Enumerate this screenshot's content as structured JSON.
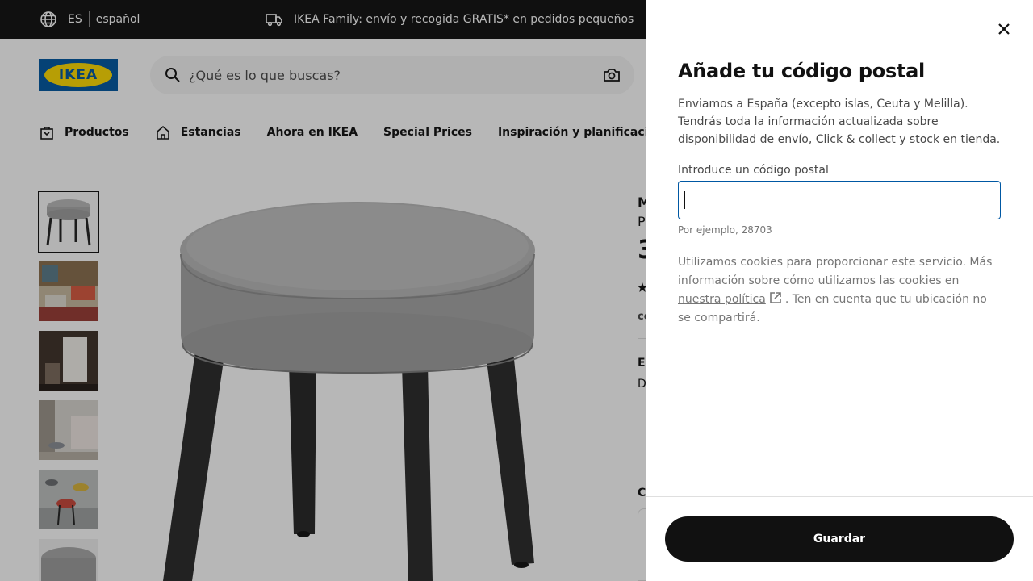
{
  "topbar": {
    "language_code": "ES",
    "language_name": "español",
    "promo_text": "IKEA Family: envío y recogida GRATIS* en pedidos pequeños"
  },
  "header": {
    "logo_text": "IKEA",
    "search_placeholder": "¿Qué es lo que buscas?"
  },
  "nav": {
    "items": [
      {
        "label": "Productos",
        "icon": "shopping-bag-icon"
      },
      {
        "label": "Estancias",
        "icon": "house-icon"
      },
      {
        "label": "Ahora en IKEA"
      },
      {
        "label": "Special Prices"
      },
      {
        "label": "Inspiración y planificación"
      }
    ]
  },
  "product": {
    "title_fragment": "M",
    "subtitle_fragment": "P",
    "price_fragment": "3",
    "detail_fragments": [
      "co",
      "El",
      "D",
      "C"
    ]
  },
  "modal": {
    "title": "Añade tu código postal",
    "description": "Enviamos a España (excepto islas, Ceuta y Melilla). Tendrás toda la información actualizada sobre disponibilidad de envío, Click & collect y stock en tienda.",
    "field_label": "Introduce un código postal",
    "field_value": "",
    "hint": "Por ejemplo, 28703",
    "cookies_before": "Utilizamos cookies para proporcionar este servicio. Más información sobre cómo utilizamos las cookies en ",
    "cookies_link": "nuestra política",
    "cookies_after": ". Ten en cuenta que tu ubicación no se compartirá.",
    "save_label": "Guardar"
  },
  "colors": {
    "topbar_bg": "#111111",
    "ikea_blue": "#0058a3",
    "ikea_yellow": "#ffdb00",
    "button_bg": "#111111"
  }
}
